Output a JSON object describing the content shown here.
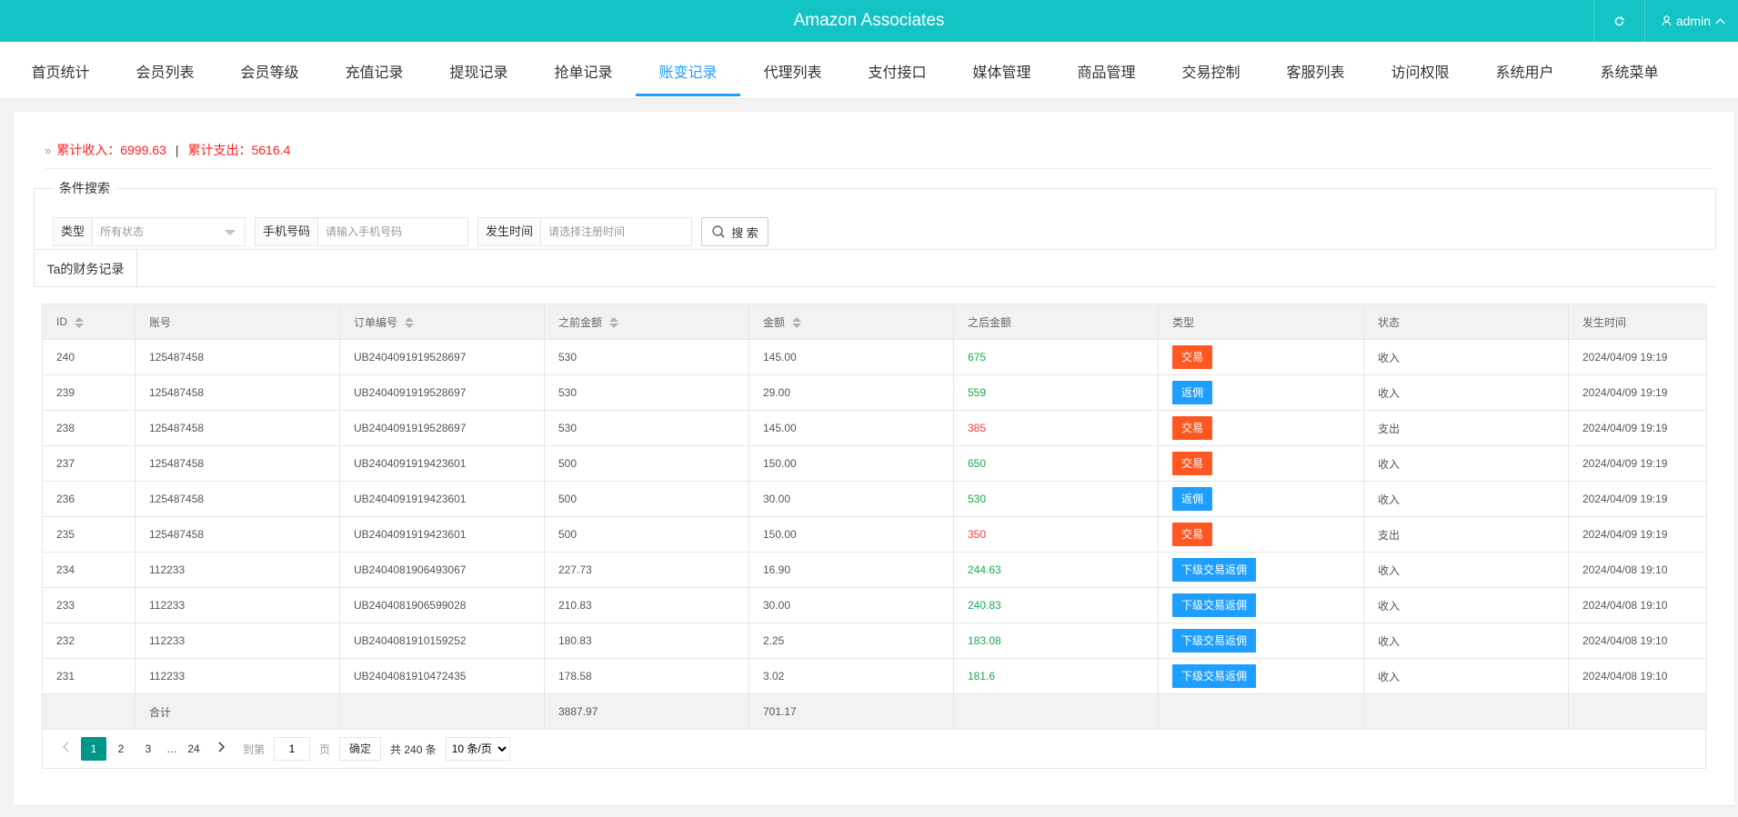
{
  "app": {
    "title": "Amazon Associates",
    "user": "admin"
  },
  "nav": [
    "首页统计",
    "会员列表",
    "会员等级",
    "充值记录",
    "提现记录",
    "抢单记录",
    "账变记录",
    "代理列表",
    "支付接口",
    "媒体管理",
    "商品管理",
    "交易控制",
    "客服列表",
    "访问权限",
    "系统用户",
    "系统菜单"
  ],
  "nav_active_index": 6,
  "summary": {
    "income_label": "累计收入：6999.63",
    "separator": "|",
    "expense_label": "累计支出：5616.4"
  },
  "search": {
    "legend": "条件搜索",
    "type_label": "类型",
    "type_value": "所有状态",
    "phone_label": "手机号码",
    "phone_placeholder": "请输入手机号码",
    "time_label": "发生时间",
    "time_placeholder": "请选择注册时间",
    "button": "搜 索"
  },
  "tab_label": "Ta的财务记录",
  "table": {
    "headers": [
      "ID",
      "账号",
      "订单编号",
      "之前金额",
      "金额",
      "之后金额",
      "类型",
      "状态",
      "发生时间"
    ],
    "rows": [
      {
        "id": "240",
        "account": "125487458",
        "order": "UB2404091919528697",
        "before": "530",
        "amount": "145.00",
        "after": "675",
        "after_color": "green",
        "type": "交易",
        "type_color": "orange",
        "status": "收入",
        "time": "2024/04/09 19:19"
      },
      {
        "id": "239",
        "account": "125487458",
        "order": "UB2404091919528697",
        "before": "530",
        "amount": "29.00",
        "after": "559",
        "after_color": "green",
        "type": "返佣",
        "type_color": "blue",
        "status": "收入",
        "time": "2024/04/09 19:19"
      },
      {
        "id": "238",
        "account": "125487458",
        "order": "UB2404091919528697",
        "before": "530",
        "amount": "145.00",
        "after": "385",
        "after_color": "red",
        "type": "交易",
        "type_color": "orange",
        "status": "支出",
        "time": "2024/04/09 19:19"
      },
      {
        "id": "237",
        "account": "125487458",
        "order": "UB2404091919423601",
        "before": "500",
        "amount": "150.00",
        "after": "650",
        "after_color": "green",
        "type": "交易",
        "type_color": "orange",
        "status": "收入",
        "time": "2024/04/09 19:19"
      },
      {
        "id": "236",
        "account": "125487458",
        "order": "UB2404091919423601",
        "before": "500",
        "amount": "30.00",
        "after": "530",
        "after_color": "green",
        "type": "返佣",
        "type_color": "blue",
        "status": "收入",
        "time": "2024/04/09 19:19"
      },
      {
        "id": "235",
        "account": "125487458",
        "order": "UB2404091919423601",
        "before": "500",
        "amount": "150.00",
        "after": "350",
        "after_color": "red",
        "type": "交易",
        "type_color": "orange",
        "status": "支出",
        "time": "2024/04/09 19:19"
      },
      {
        "id": "234",
        "account": "112233",
        "order": "UB2404081906493067",
        "before": "227.73",
        "amount": "16.90",
        "after": "244.63",
        "after_color": "green",
        "type": "下级交易返佣",
        "type_color": "blue",
        "status": "收入",
        "time": "2024/04/08 19:10"
      },
      {
        "id": "233",
        "account": "112233",
        "order": "UB2404081906599028",
        "before": "210.83",
        "amount": "30.00",
        "after": "240.83",
        "after_color": "green",
        "type": "下级交易返佣",
        "type_color": "blue",
        "status": "收入",
        "time": "2024/04/08 19:10"
      },
      {
        "id": "232",
        "account": "112233",
        "order": "UB2404081910159252",
        "before": "180.83",
        "amount": "2.25",
        "after": "183.08",
        "after_color": "green",
        "type": "下级交易返佣",
        "type_color": "blue",
        "status": "收入",
        "time": "2024/04/08 19:10"
      },
      {
        "id": "231",
        "account": "112233",
        "order": "UB2404081910472435",
        "before": "178.58",
        "amount": "3.02",
        "after": "181.6",
        "after_color": "green",
        "type": "下级交易返佣",
        "type_color": "blue",
        "status": "收入",
        "time": "2024/04/08 19:10"
      }
    ],
    "total": {
      "label": "合计",
      "before": "3887.97",
      "amount": "701.17"
    }
  },
  "pager": {
    "pages": [
      "1",
      "2",
      "3"
    ],
    "ellipsis": "…",
    "last": "24",
    "goto_label": "到第",
    "goto_value": "1",
    "page_unit": "页",
    "confirm": "确定",
    "total": "共 240 条",
    "per_page": "10 条/页"
  },
  "colors": {
    "header": "#14c3c3",
    "active": "#1e9fff",
    "orange": "#ff5722",
    "blue": "#1e9fff",
    "green": "#1aa94b",
    "red": "#ff3b3b",
    "page_current": "#009688"
  }
}
